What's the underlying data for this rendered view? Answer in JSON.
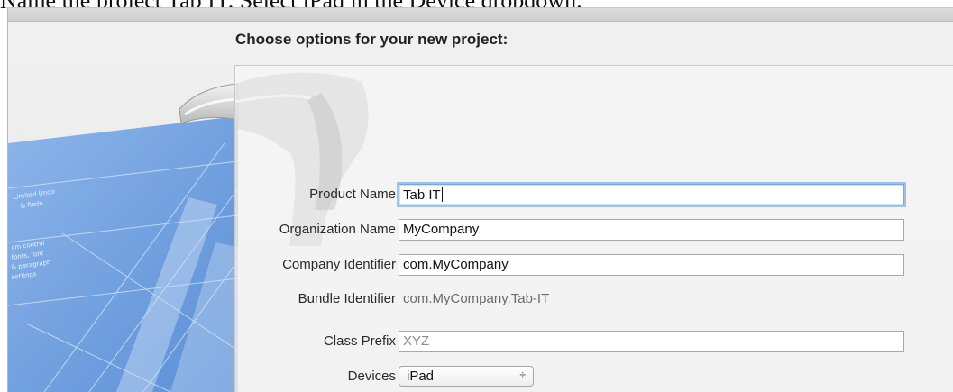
{
  "instruction": "Name the project Tab IT. Select iPad in the Device dropdown.",
  "dialog": {
    "heading": "Choose options for your new project:"
  },
  "form": {
    "product_name": {
      "label": "Product Name",
      "value": "Tab IT"
    },
    "organization_name": {
      "label": "Organization Name",
      "value": "MyCompany"
    },
    "company_identifier": {
      "label": "Company Identifier",
      "value": "com.MyCompany"
    },
    "bundle_identifier": {
      "label": "Bundle Identifier",
      "value": "com.MyCompany.Tab-IT"
    },
    "class_prefix": {
      "label": "Class Prefix",
      "placeholder": "XYZ"
    },
    "devices": {
      "label": "Devices",
      "selected": "iPad",
      "arrows": "÷"
    }
  },
  "colors": {
    "blueprint": "#6f9fde",
    "focus_ring": "#9cc3ec",
    "panel_border": "#c9c9c9"
  },
  "icons": [
    "xcode-blueprint-hammer-icon",
    "select-arrows-icon"
  ]
}
